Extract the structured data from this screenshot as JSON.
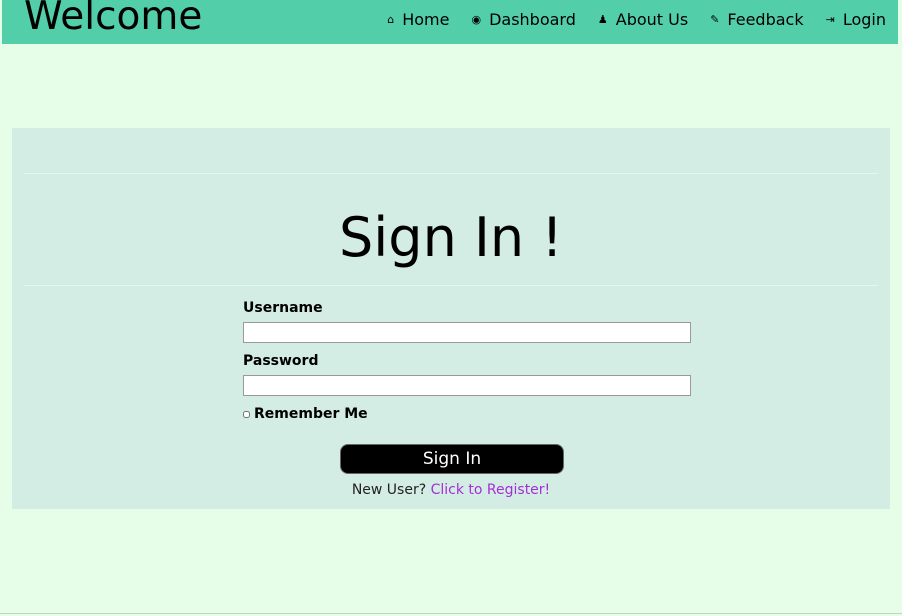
{
  "header": {
    "brand": "Welcome",
    "nav": [
      {
        "label": "Home",
        "icon": "home-icon",
        "glyph": "⌂"
      },
      {
        "label": "Dashboard",
        "icon": "dashboard-icon",
        "glyph": "◉"
      },
      {
        "label": "About Us",
        "icon": "user-icon",
        "glyph": "♟"
      },
      {
        "label": "Feedback",
        "icon": "pencil-icon",
        "glyph": "✎"
      },
      {
        "label": "Login",
        "icon": "login-icon",
        "glyph": "⇥"
      }
    ]
  },
  "form": {
    "title": "Sign In !",
    "username_label": "Username",
    "username_value": "",
    "password_label": "Password",
    "password_value": "",
    "remember_label": "Remember Me",
    "submit_label": "Sign In",
    "register_prompt": "New User?",
    "register_link": "Click to Register!"
  },
  "colors": {
    "header": "#52cfa8",
    "background": "#e6fde8",
    "panel": "#d4ede4",
    "link": "#a52fd6"
  }
}
